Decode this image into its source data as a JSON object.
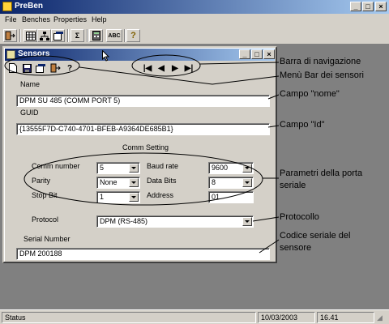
{
  "app": {
    "title": "PreBen"
  },
  "menu": [
    "File",
    "Benches",
    "Properties",
    "Help"
  ],
  "toolbar": {
    "icons": [
      "exit-icon",
      "grid-icon",
      "tree-icon",
      "properties-icon",
      "sigma-icon",
      "calculator-icon",
      "abc-icon",
      "help-icon"
    ],
    "sigma": "Σ",
    "abc": "ABC",
    "help": "?"
  },
  "child": {
    "title": "Sensors",
    "toolbar": {
      "help": "?",
      "first": "|◀",
      "prev": "◀",
      "next": "▶",
      "last": "▶|"
    },
    "name_label": "Name",
    "name_value": "DPM SU 485 (COMM PORT 5)",
    "guid_label": "GUID",
    "guid_value": "{13555F7D-C740-4701-BFEB-A9364DE685B1}",
    "comm_heading": "Comm Setting",
    "comm_number_label": "Comm number",
    "comm_number_value": "5",
    "parity_label": "Parity",
    "parity_value": "None",
    "stop_bit_label": "Stop Bit",
    "stop_bit_value": "1",
    "baud_rate_label": "Baud rate",
    "baud_rate_value": "9600",
    "data_bits_label": "Data Bits",
    "data_bits_value": "8",
    "address_label": "Address",
    "address_value": "01",
    "protocol_label": "Protocol",
    "protocol_value": "DPM (RS-485)",
    "serial_label": "Serial Number",
    "serial_value": "DPM 200188"
  },
  "annotations": {
    "nav_bar": "Barra di navigazione",
    "menu_bar": "Menù Bar dei sensori",
    "name_field": "Campo \"nome\"",
    "id_field": "Campo \"Id\"",
    "port_params_line1": "Parametri della porta",
    "port_params_line2": "seriale",
    "protocol": "Protocollo",
    "serial_code_line1": "Codice seriale del",
    "serial_code_line2": "sensore"
  },
  "status": {
    "text": "Status",
    "date": "10/03/2003",
    "time": "16.41"
  }
}
